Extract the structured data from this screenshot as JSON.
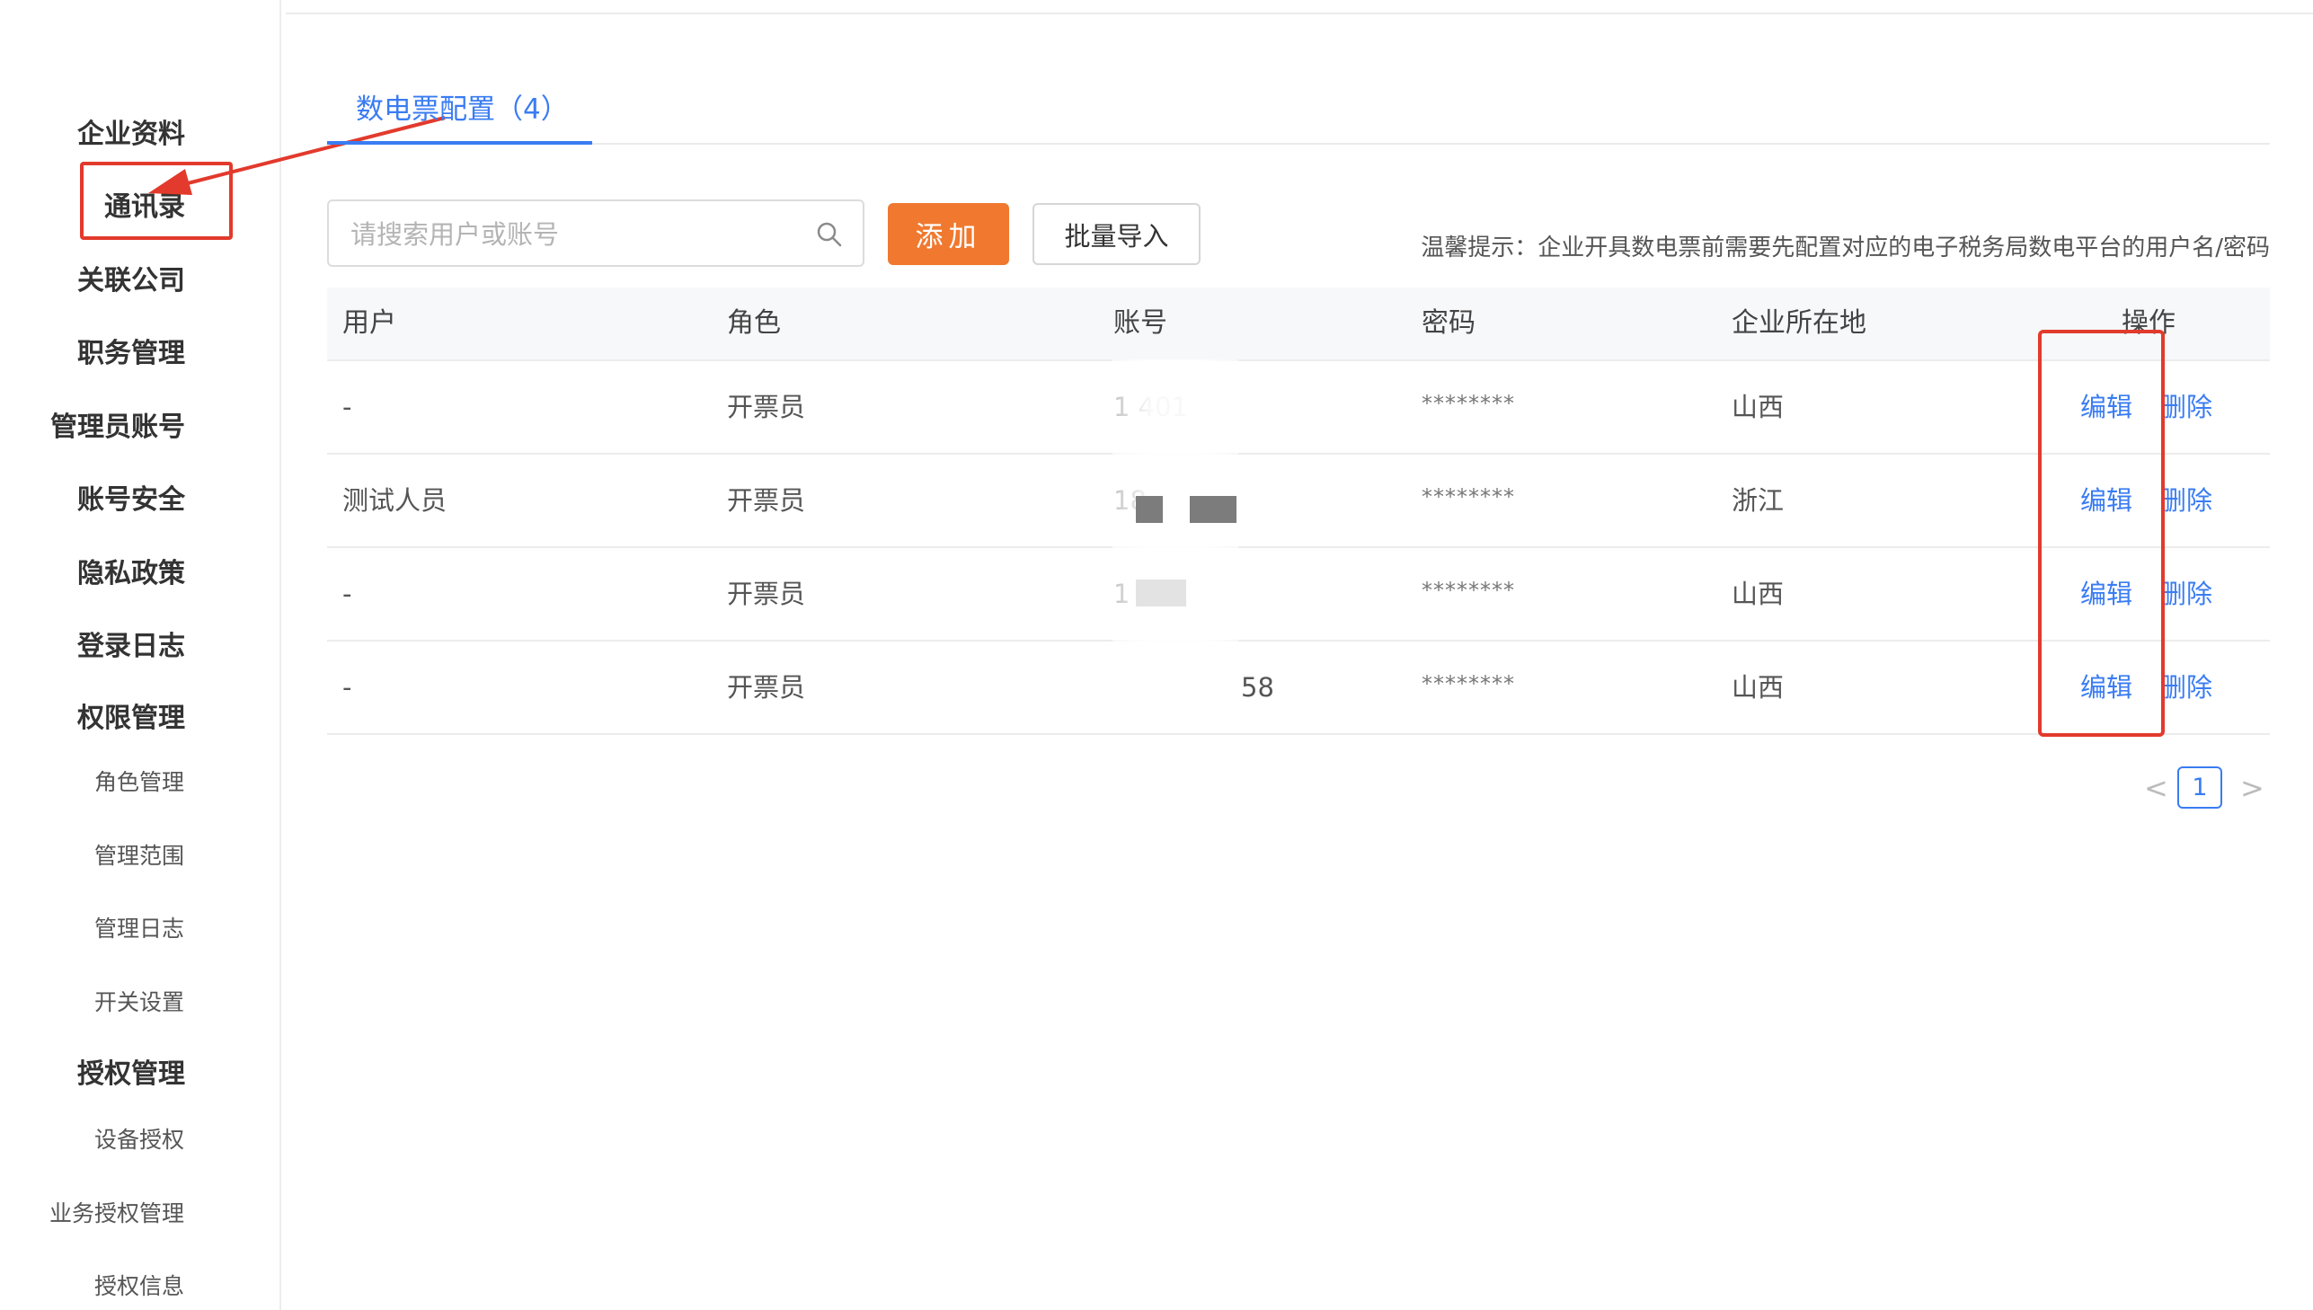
{
  "colors": {
    "accent": "#3a7cf2",
    "primary_button": "#f0792f",
    "annotation_red": "#e23a2c"
  },
  "sidebar": {
    "items": [
      {
        "label": "企业资料",
        "level": "main"
      },
      {
        "label": "通讯录",
        "level": "main"
      },
      {
        "label": "关联公司",
        "level": "main"
      },
      {
        "label": "职务管理",
        "level": "main"
      },
      {
        "label": "管理员账号",
        "level": "main"
      },
      {
        "label": "账号安全",
        "level": "main"
      },
      {
        "label": "隐私政策",
        "level": "main"
      },
      {
        "label": "登录日志",
        "level": "main"
      },
      {
        "label": "权限管理",
        "level": "main"
      },
      {
        "label": "角色管理",
        "level": "sub"
      },
      {
        "label": "管理范围",
        "level": "sub"
      },
      {
        "label": "管理日志",
        "level": "sub"
      },
      {
        "label": "开关设置",
        "level": "sub"
      },
      {
        "label": "授权管理",
        "level": "main"
      },
      {
        "label": "设备授权",
        "level": "sub"
      },
      {
        "label": "业务授权管理",
        "level": "sub"
      },
      {
        "label": "授权信息",
        "level": "sub"
      }
    ]
  },
  "tabs": [
    {
      "label": "数电票配置（4）",
      "active": true
    }
  ],
  "toolbar": {
    "search_placeholder": "请搜索用户或账号",
    "search_icon": "search-icon",
    "add_label": "添加",
    "import_label": "批量导入",
    "tip": "温馨提示：企业开具数电票前需要先配置对应的电子税务局数电平台的用户名/密码"
  },
  "table": {
    "columns": [
      "用户",
      "角色",
      "账号",
      "密码",
      "企业所在地",
      "操作"
    ],
    "rows": [
      {
        "user": "-",
        "role": "开票员",
        "account": "1       401",
        "password": "********",
        "region": "山西"
      },
      {
        "user": "测试人员",
        "role": "开票员",
        "account": "18",
        "password": "********",
        "region": "浙江"
      },
      {
        "user": "-",
        "role": "开票员",
        "account": "1",
        "password": "********",
        "region": "山西"
      },
      {
        "user": "-",
        "role": "开票员",
        "account": "58",
        "password": "********",
        "region": "山西"
      }
    ],
    "actions": {
      "edit": "编辑",
      "delete": "删除"
    }
  },
  "pagination": {
    "prev": "<",
    "current": "1",
    "next": ">"
  }
}
